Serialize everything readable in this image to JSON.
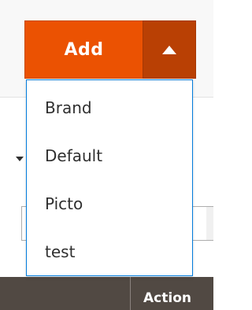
{
  "add_button": {
    "label": "Add",
    "toggle_icon": "caret-up-icon",
    "main_color": "#eb5202",
    "toggle_color": "#b94004"
  },
  "dropdown": {
    "border_color": "#007bdb",
    "items": [
      {
        "label": "Brand"
      },
      {
        "label": "Default"
      },
      {
        "label": "Picto"
      },
      {
        "label": "test"
      }
    ]
  },
  "grid": {
    "header_color": "#514943",
    "action_header": "Action"
  }
}
